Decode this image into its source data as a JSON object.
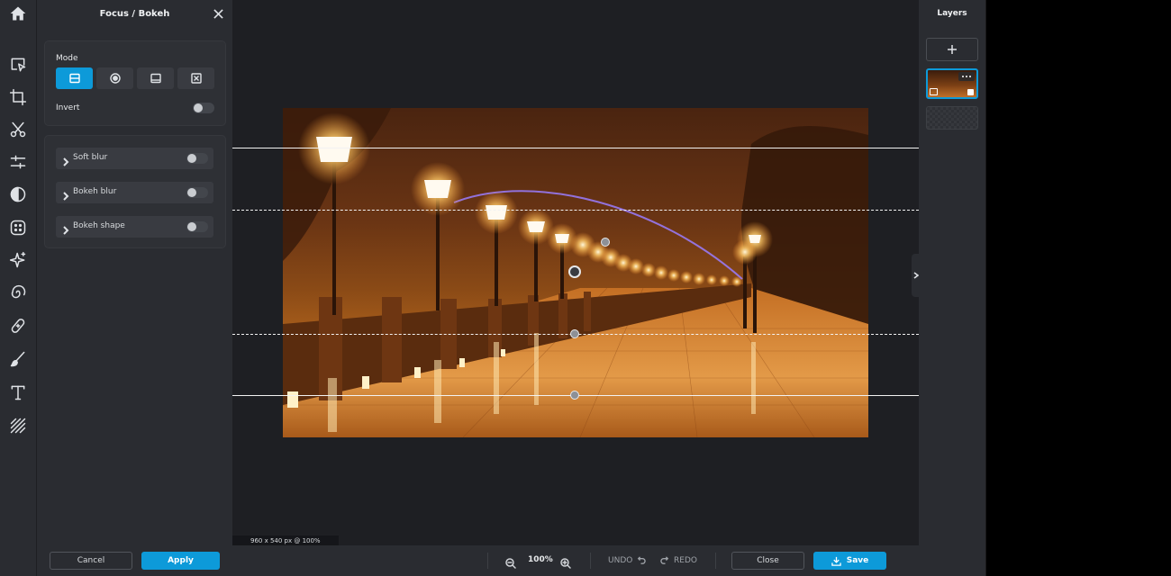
{
  "panel": {
    "title": "Focus / Bokeh",
    "mode_label": "Mode",
    "invert_label": "Invert",
    "options": [
      {
        "label": "Soft blur"
      },
      {
        "label": "Bokeh blur"
      },
      {
        "label": "Bokeh shape"
      }
    ],
    "cancel_label": "Cancel",
    "apply_label": "Apply"
  },
  "canvas": {
    "dimensions": "960 x 540 px @ 100%"
  },
  "toolbar": {
    "zoom": "100%",
    "undo_label": "UNDO",
    "redo_label": "REDO",
    "close_label": "Close",
    "save_label": "Save"
  },
  "layers": {
    "title": "Layers"
  },
  "colors": {
    "accent": "#0d9ad9",
    "panel_bg": "#2a2c31",
    "canvas_bg": "#1e1f23"
  }
}
